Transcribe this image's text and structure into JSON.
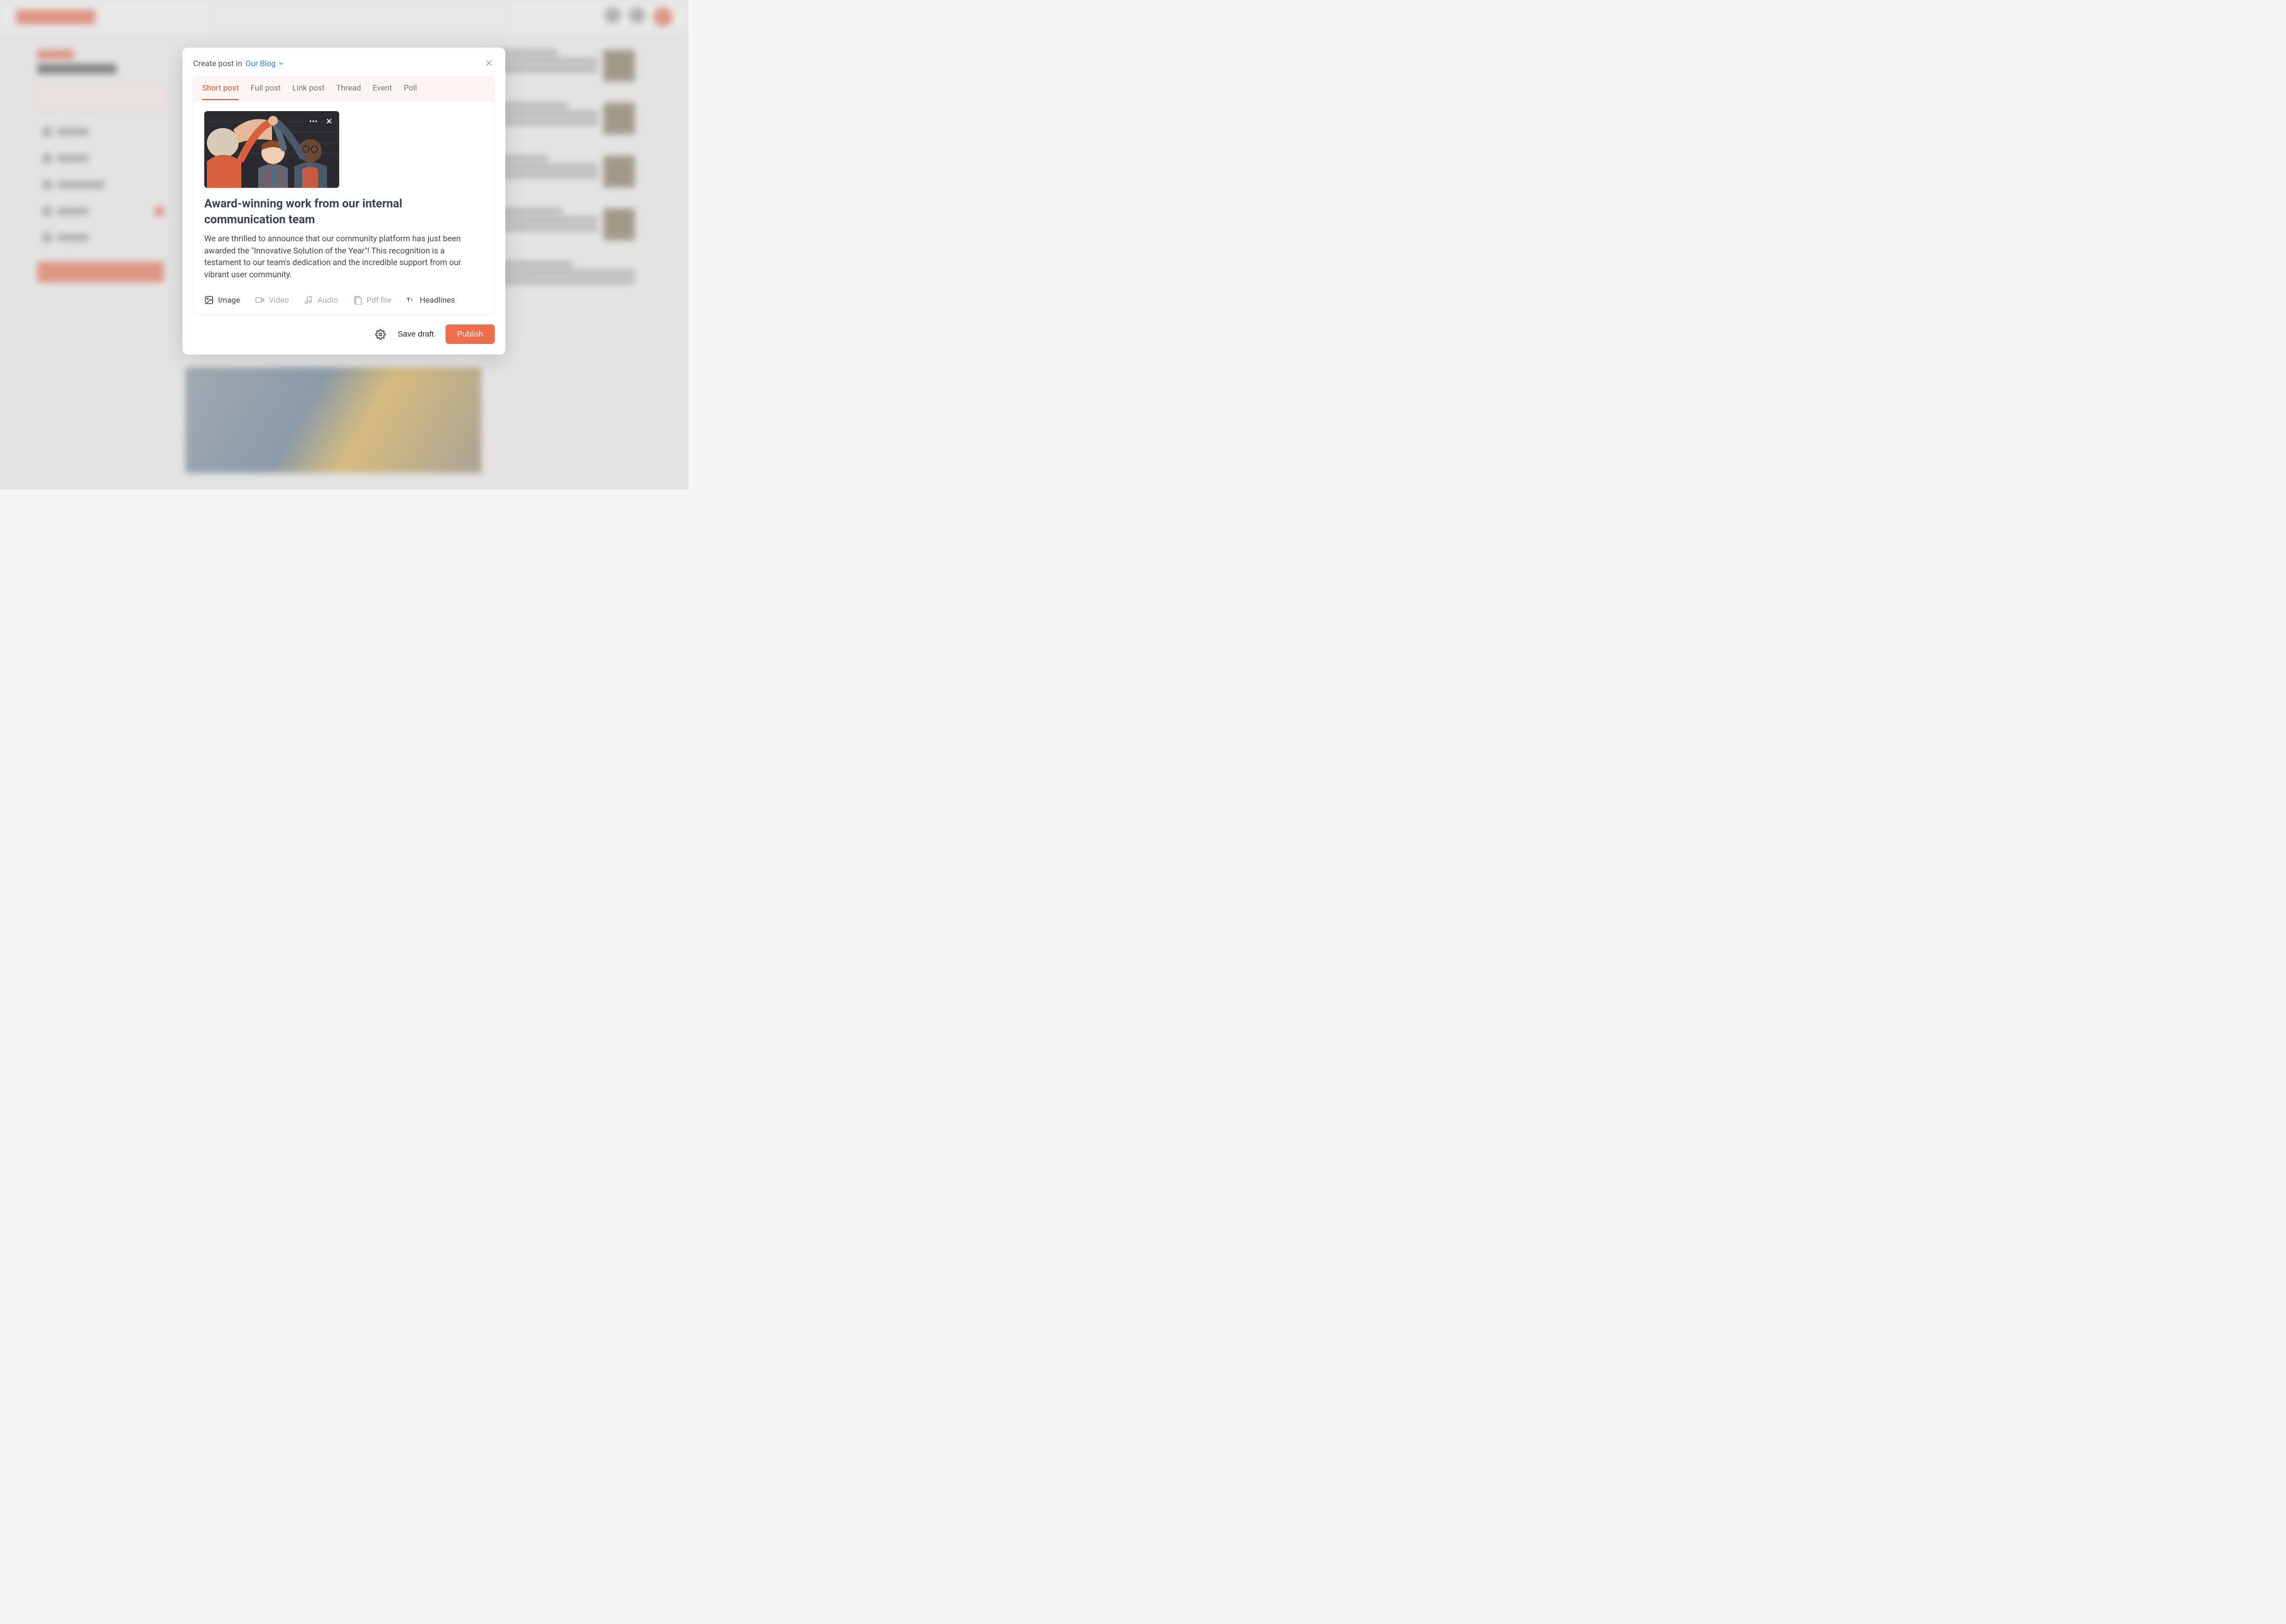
{
  "modal": {
    "header": {
      "prefix": "Create post in",
      "target": "Our Blog"
    },
    "tabs": [
      "Short post",
      "Full post",
      "Link post",
      "Thread",
      "Event",
      "Poll"
    ],
    "active_tab_index": 0,
    "post": {
      "title": "Award-winning work from our internal communication team",
      "body": "We are thrilled to announce that our community platform has just been awarded the \"Innovative Solution of the Year\"! This recognition is a testament to our team's dedication and the incredible support from our vibrant user community."
    },
    "media": [
      {
        "key": "image",
        "label": "Image",
        "enabled": true
      },
      {
        "key": "video",
        "label": "Video",
        "enabled": false
      },
      {
        "key": "audio",
        "label": "Audio",
        "enabled": false
      },
      {
        "key": "pdf",
        "label": "Pdf file",
        "enabled": false
      },
      {
        "key": "headlines",
        "label": "Headlines",
        "enabled": true
      }
    ],
    "footer": {
      "save_draft": "Save draft",
      "publish": "Publish"
    }
  }
}
